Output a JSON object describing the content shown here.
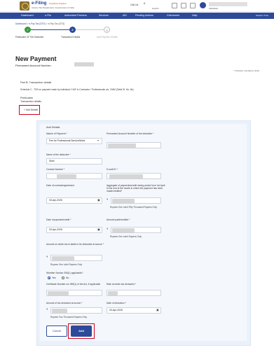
{
  "header": {
    "logo_title": "e-Filing",
    "logo_tagline": "Anywhere Anytime",
    "logo_dept": "Income Tax Department, Government of India",
    "call_us": "Call Us",
    "language": "English",
    "user_type": "Individual"
  },
  "nav": {
    "items": [
      "Dashboard",
      "e-File",
      "Authorised Partners",
      "Services",
      "AIS",
      "Pending Actions",
      "Grievances",
      "Help"
    ],
    "active_index": 0,
    "session_time": "Session Time"
  },
  "breadcrumb": [
    "Dashboard",
    "e-Pay Tax (DTD)",
    "e-Pay Tax (DTD)"
  ],
  "stepper": [
    {
      "num": "1",
      "label": "Particulars Of The Deductee",
      "state": "done"
    },
    {
      "num": "2",
      "label": "Transaction Details",
      "state": "active"
    },
    {
      "num": "3",
      "label": "Add Payment Details",
      "state": "pending"
    }
  ],
  "page": {
    "title": "New Payment",
    "pan_label": "Permanent Account Number :",
    "mandatory_note": "* Indicates mandatory fields",
    "partb_title": "Part B: Transaction details",
    "partb_schedule": "Schedule C - TDS on payment made by Individual / HUF to Contractor / Professionals u/s. 194M (Table SI. No. 6b)",
    "particulars": "Particulars",
    "transaction_details": "Transaction details",
    "add_details_link": "+ Add Details"
  },
  "form": {
    "heading": "Add Details",
    "nature_label": "Nature of Payment *",
    "nature_value": "Fee for Professional Service/Work",
    "pan_deductee_label": "Permanent Account Number of the deductee *",
    "name_label": "Name of the deductee *",
    "name_value": "Dinki",
    "contact_label": "Contact Number *",
    "email_label": "E-mail ID *",
    "contract_date_label": "Date of contract/agreement",
    "contract_date_value": "03-Apr-2026",
    "aggregate_label": "Aggregate of payments/credit during period from 1st April to the end of the month in which the payment has been made/credited*",
    "aggregate_help": "Rupees One Lakh Fifty Thousand Rupees Only",
    "payment_date_label": "Date of payment/credit *",
    "payment_date_value": "03-Apr-2026",
    "amount_paid_label": "Amount paid/credited *",
    "amount_paid_help": "Rupees One Lakh Rupees Only",
    "amount_deducted_label": "Amount on which tax is liable to be deducted at source *",
    "amount_deducted_help": "Rupees One Lakh Rupees Only",
    "section_label": "Whether Section 395(1) applicable?",
    "radio_yes": "Yes",
    "radio_no": "No",
    "certificate_label": "Certificate Number u/s 395(1) of the Act, if applicable",
    "rate_label": "Rate at which tax deducted *",
    "tax_deducted_label": "Amount of tax deducted at source *",
    "tax_deducted_help": "Rupees Two Thousand Rupees Only",
    "deduction_date_label": "Date of deduction *",
    "deduction_date_value": "03-Apr-2026",
    "rupee_symbol": "₹",
    "calendar_glyph": "▣",
    "chevron_glyph": "▾",
    "cancel_label": "Cancel",
    "add_label": "Add"
  },
  "colors": {
    "brand": "#2d4a9a",
    "highlight": "#d0021b",
    "panel": "#eaf1fb"
  }
}
